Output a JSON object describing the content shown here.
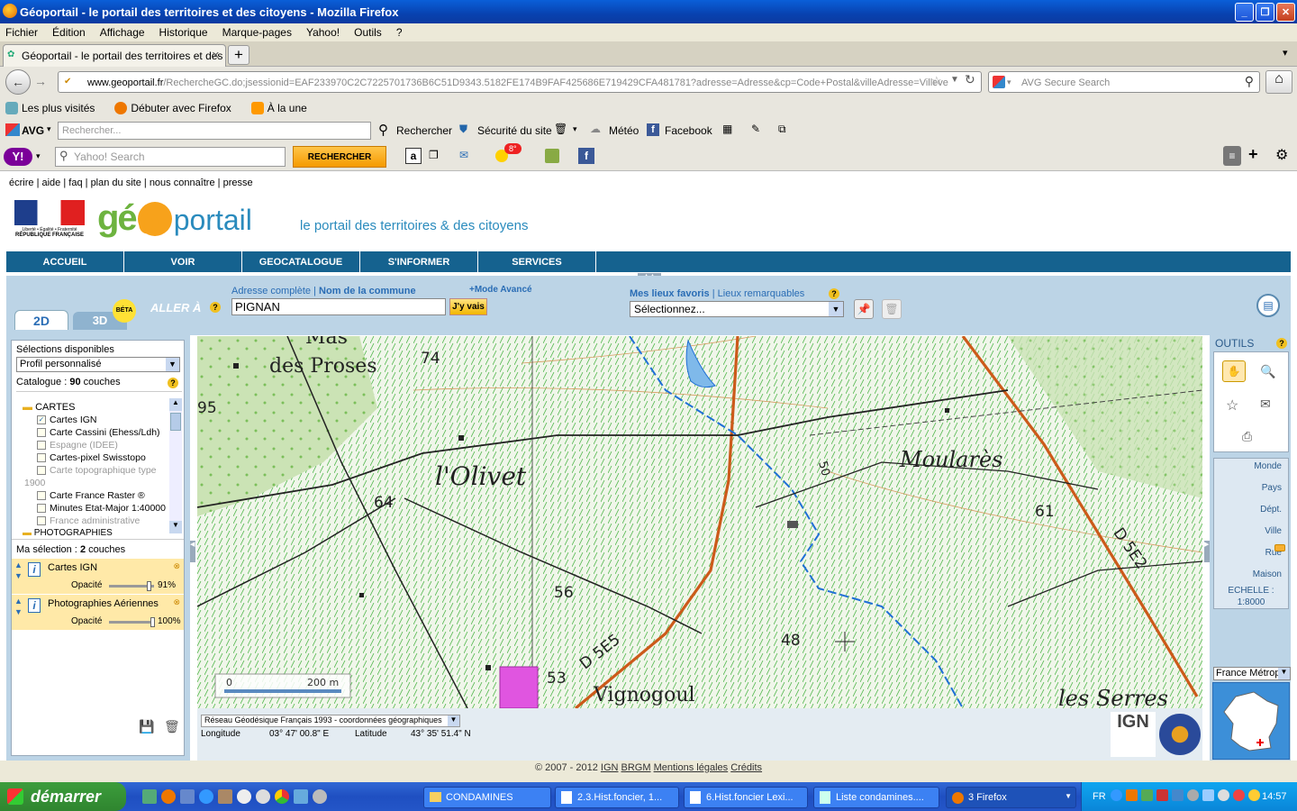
{
  "window": {
    "title": "Géoportail - le portail des territoires et des citoyens - Mozilla Firefox"
  },
  "menu": [
    "Fichier",
    "Édition",
    "Affichage",
    "Historique",
    "Marque-pages",
    "Yahoo!",
    "Outils",
    "?"
  ],
  "tab": {
    "label": "Géoportail - le portail des territoires et des ci..."
  },
  "nav": {
    "url_domain": "www.geoportail.fr",
    "url_rest": "/RechercheGC.do;jsessionid=EAF233970C2C7225701736B6C51D9343.5182FE174B9FAF425686E719429CFA481781?adresse=Adresse&cp=Code+Postal&villeAdresse=Villeve",
    "search_placeholder": "AVG Secure Search"
  },
  "bookmarks": [
    "Les plus visités",
    "Débuter avec Firefox",
    "À la une"
  ],
  "avg": {
    "label": "AVG",
    "placeholder": "Rechercher...",
    "search": "Rechercher",
    "security": "Sécurité du site",
    "weather": "Météo",
    "facebook": "Facebook"
  },
  "yahoo": {
    "placeholder": "Yahoo! Search",
    "button": "RECHERCHER",
    "badge": "8°"
  },
  "sitelinks": [
    "écrire",
    "aide",
    "faq",
    "plan du site",
    "nous connaître",
    "presse"
  ],
  "header": {
    "rf1": "Liberté • Égalité • Fraternité",
    "rf2": "RÉPUBLIQUE FRANÇAISE",
    "logo_ge": "gé",
    "logo_o": "o",
    "logo_portail": "portail",
    "tagline": "le portail des territoires & des citoyens"
  },
  "mainnav": [
    "ACCUEIL",
    "VOIR",
    "GEOCATALOGUE",
    "S'INFORMER",
    "SERVICES"
  ],
  "toolband": {
    "tab2d": "2D",
    "tab3d": "3D",
    "beta": "BÉTA",
    "goto": "ALLER À",
    "addr_label": "Adresse complète",
    "commune_label": "Nom de la commune",
    "advanced": "+Mode Avancé",
    "input_value": "PIGNAN",
    "go_button": "J'y vais",
    "fav_label": "Mes lieux favoris",
    "remarkable": "Lieux remarquables",
    "select_value": "Sélectionnez..."
  },
  "left": {
    "selections_label": "Sélections disponibles",
    "profile": "Profil personnalisé",
    "catalogue_label": "Catalogue :",
    "catalogue_count": "90",
    "catalogue_unit": "couches",
    "folder": "CARTES",
    "layers": [
      {
        "name": "Cartes IGN",
        "checked": true,
        "enabled": true
      },
      {
        "name": "Carte Cassini (Ehess/Ldh)",
        "checked": false,
        "enabled": true
      },
      {
        "name": "Espagne (IDEE)",
        "checked": false,
        "enabled": false
      },
      {
        "name": "Cartes-pixel Swisstopo",
        "checked": false,
        "enabled": true
      },
      {
        "name": "Carte topographique type",
        "checked": false,
        "enabled": false
      },
      {
        "name": "1900",
        "checked": false,
        "enabled": false,
        "cont": true
      },
      {
        "name": "Carte France Raster ®",
        "checked": false,
        "enabled": true
      },
      {
        "name": "Minutes Etat-Major 1:40000",
        "checked": false,
        "enabled": true
      },
      {
        "name": "France administrative",
        "checked": false,
        "enabled": false
      }
    ],
    "folder2": "PHOTOGRAPHIES",
    "mysel_label": "Ma sélection :",
    "mysel_count": "2",
    "mysel_unit": "couches",
    "selected": [
      {
        "name": "Cartes IGN",
        "opacity_label": "Opacité",
        "opacity": "91%",
        "opacity_value": 0.91
      },
      {
        "name": "Photographies Aériennes",
        "opacity_label": "Opacité",
        "opacity": "100%",
        "opacity_value": 1.0
      }
    ]
  },
  "map": {
    "labels": [
      "Mas",
      "des Proses",
      "74",
      "95",
      "l'Olivet",
      "64",
      "56",
      "D 5E5",
      "53",
      "48",
      "Vignogoul",
      "Moularès",
      "61",
      "D 5E2",
      "les Serres",
      "50"
    ],
    "scale_zero": "0",
    "scale_dist": "200 m",
    "projection": "Réseau Géodésique Français 1993 - coordonnées géographiques",
    "lon_label": "Longitude",
    "lon_value": "03° 47' 00.8\" E",
    "lat_label": "Latitude",
    "lat_value": "43° 35' 51.4\" N",
    "ign_logo": "IGN"
  },
  "right": {
    "tools_label": "OUTILS",
    "zoom_levels": [
      "Monde",
      "Pays",
      "Dépt.",
      "Ville",
      "Rue",
      "Maison"
    ],
    "scale_label": "ECHELLE :",
    "scale_value": "1:8000",
    "region": "France Métrop"
  },
  "footer": {
    "copyright": "© 2007 - 2012",
    "links": [
      "IGN",
      "BRGM",
      "Mentions légales",
      "Crédits"
    ]
  },
  "taskbar": {
    "start": "démarrer",
    "items": [
      "CONDAMINES",
      "2.3.Hist.foncier, 1...",
      "6.Hist.foncier Lexi...",
      "Liste condamines....",
      "3 Firefox"
    ],
    "lang": "FR",
    "clock": "14:57"
  }
}
